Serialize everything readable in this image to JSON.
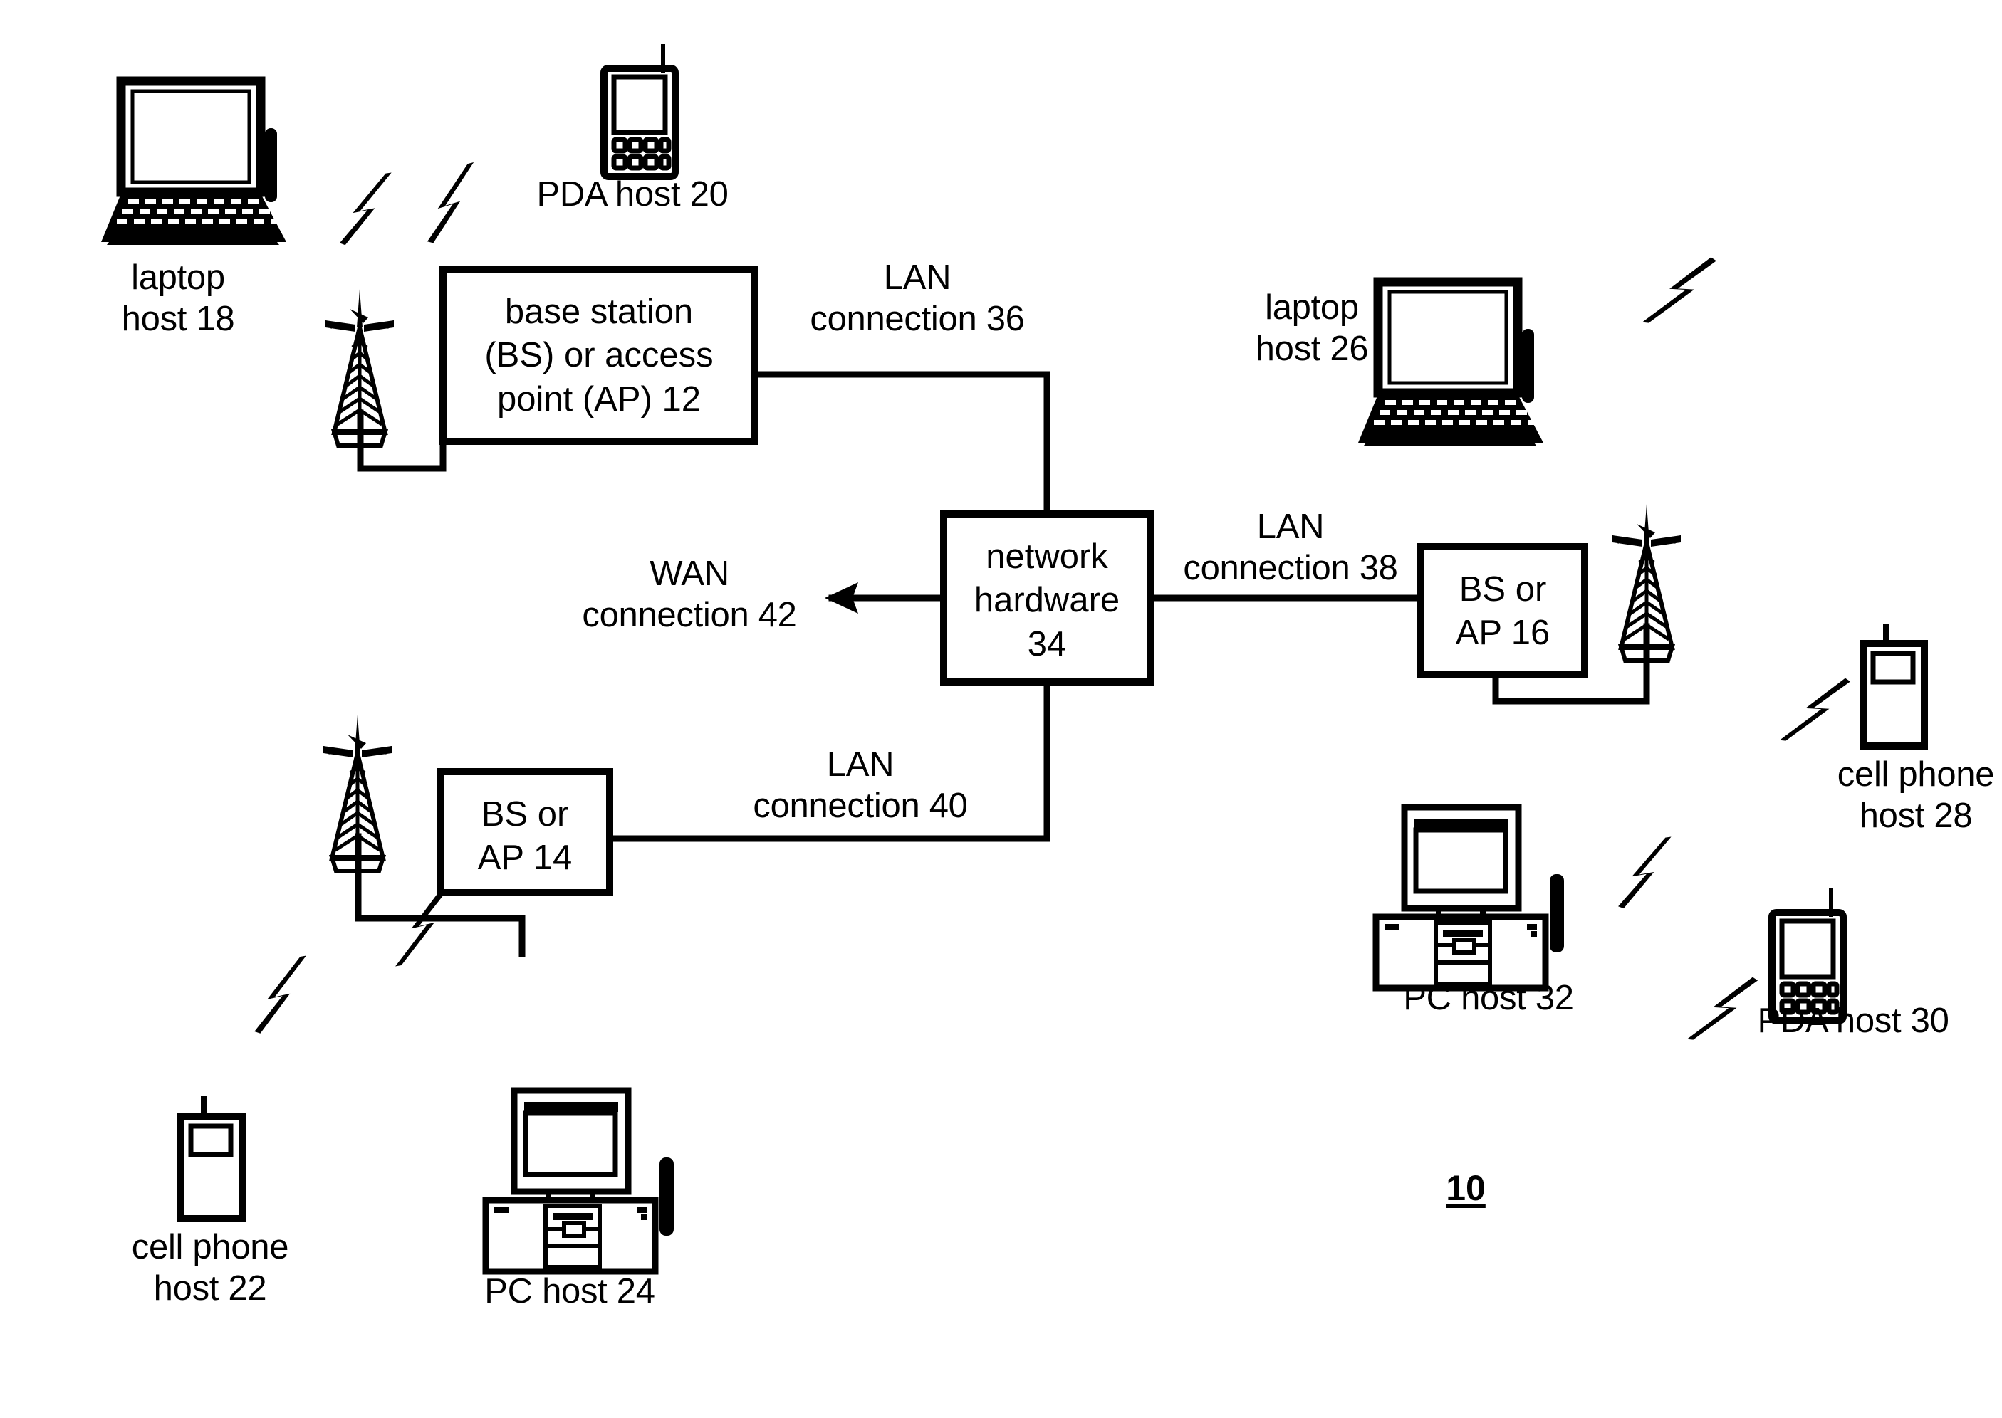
{
  "figure": {
    "number": "10",
    "background_color": "#ffffff",
    "line_color": "#000000"
  },
  "boxes": [
    {
      "id": "bs-ap-12",
      "name": "base-station-ap-12",
      "lines": [
        "base station",
        "(BS) or access",
        "point (AP) 12"
      ],
      "text": "base station\n(BS) or access\npoint (AP) 12"
    },
    {
      "id": "network-hardware-34",
      "name": "network-hardware-34",
      "lines": [
        "network",
        "hardware",
        "34"
      ],
      "text": "network\nhardware\n34"
    },
    {
      "id": "bs-ap-16",
      "name": "bs-ap-16",
      "lines": [
        "BS or",
        "AP 16"
      ],
      "text": "BS or\nAP 16"
    },
    {
      "id": "bs-ap-14",
      "name": "bs-ap-14",
      "lines": [
        "BS or",
        "AP 14"
      ],
      "text": "BS or\nAP 14"
    }
  ],
  "connections": [
    {
      "id": "lan-36",
      "text": "LAN\nconnection 36"
    },
    {
      "id": "lan-38",
      "text": "LAN\nconnection 38"
    },
    {
      "id": "lan-40",
      "text": "LAN\nconnection 40"
    },
    {
      "id": "wan-42",
      "text": "WAN\nconnection 42"
    }
  ],
  "hosts": [
    {
      "id": "laptop-18",
      "icon": "laptop-icon",
      "text": "laptop\nhost 18"
    },
    {
      "id": "pda-20",
      "icon": "pda-icon",
      "text": "PDA host 20"
    },
    {
      "id": "cellphone-22",
      "icon": "cellphone-icon",
      "text": "cell phone\nhost 22"
    },
    {
      "id": "pc-24",
      "icon": "desktop-pc-icon",
      "text": "PC host 24"
    },
    {
      "id": "laptop-26",
      "icon": "laptop-icon",
      "text": "laptop\nhost 26"
    },
    {
      "id": "cellphone-28",
      "icon": "cellphone-icon",
      "text": "cell phone\nhost 28"
    },
    {
      "id": "pda-30",
      "icon": "pda-icon",
      "text": "PDA host 30"
    },
    {
      "id": "pc-32",
      "icon": "desktop-pc-icon",
      "text": "PC host 32"
    }
  ],
  "antenna_towers": [
    {
      "id": "tower-12",
      "icon": "antenna-tower-icon"
    },
    {
      "id": "tower-14",
      "icon": "antenna-tower-icon"
    },
    {
      "id": "tower-16",
      "icon": "antenna-tower-icon"
    }
  ],
  "wireless_links": [
    {
      "id": "bolt-laptop18",
      "icon": "lightning-bolt-icon"
    },
    {
      "id": "bolt-pda20",
      "icon": "lightning-bolt-icon"
    },
    {
      "id": "bolt-cell22",
      "icon": "lightning-bolt-icon"
    },
    {
      "id": "bolt-pc24",
      "icon": "lightning-bolt-icon"
    },
    {
      "id": "bolt-laptop26",
      "icon": "lightning-bolt-icon"
    },
    {
      "id": "bolt-cell28",
      "icon": "lightning-bolt-icon"
    },
    {
      "id": "bolt-pda30",
      "icon": "lightning-bolt-icon"
    },
    {
      "id": "bolt-pc32",
      "icon": "lightning-bolt-icon"
    }
  ]
}
